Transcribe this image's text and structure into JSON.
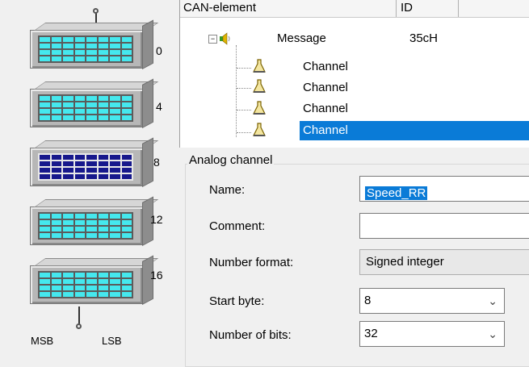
{
  "byte_panel": {
    "offsets": [
      "0",
      "4",
      "8",
      "12",
      "16"
    ],
    "msb_label": "MSB",
    "lsb_label": "LSB"
  },
  "tree": {
    "headers": {
      "element": "CAN-element",
      "id": "ID"
    },
    "message": {
      "label": "Message",
      "id": "35cH",
      "expander": "−"
    },
    "channels": [
      "Channel",
      "Channel",
      "Channel",
      "Channel"
    ]
  },
  "analog": {
    "group_title": "Analog channel",
    "name_label": "Name:",
    "name_value": "Speed_RR",
    "comment_label": "Comment:",
    "comment_value": "",
    "number_format_label": "Number format:",
    "number_format_value": "Signed integer",
    "start_byte_label": "Start byte:",
    "start_byte_value": "8",
    "num_bits_label": "Number of bits:",
    "num_bits_value": "32"
  },
  "colors": {
    "selection": "#0a7bd7",
    "cell_active": "#17188c",
    "cell_idle": "#45e8ee"
  }
}
